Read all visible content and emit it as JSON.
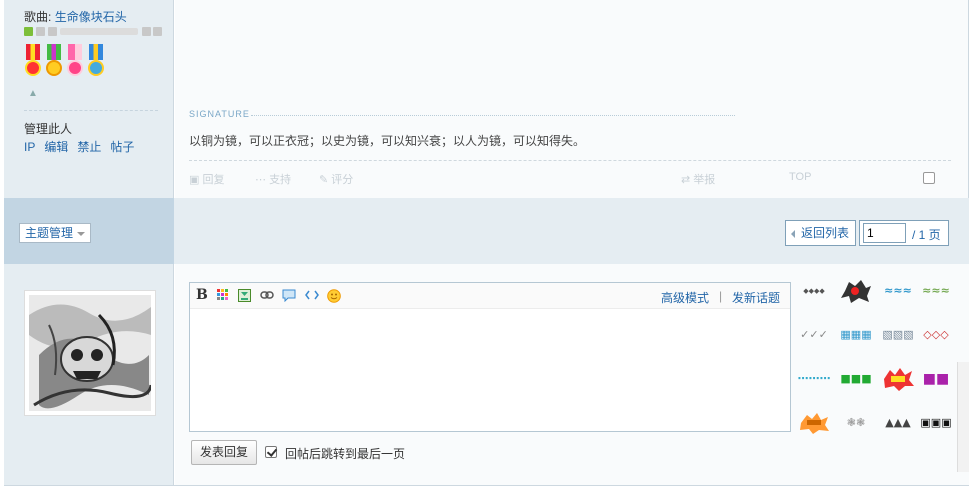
{
  "author": {
    "song_prefix": "歌曲:",
    "song_title": "生命像块石头",
    "manage_title": "管理此人",
    "manage_links": [
      "IP",
      "编辑",
      "禁止",
      "帖子"
    ]
  },
  "post": {
    "signature_label": "SIGNATURE",
    "signature_text": "以铜为镜，可以正衣冠；以史为镜，可以知兴衰；以人为镜，可以知得失。",
    "actions": [
      "回复",
      "支持",
      "评分",
      "举报",
      "TOP"
    ]
  },
  "manage_bar": {
    "topic_manage": "主题管理",
    "back_to_list": "返回列表",
    "page_value": "1",
    "page_total": "/ 1 页"
  },
  "reply": {
    "advanced_mode": "高级模式",
    "separator": "|",
    "new_topic": "发新话题",
    "submit": "发表回复",
    "jump_label": "回帖后跳转到最后一页",
    "jump_checked": true,
    "toolbar_icons": [
      "bold-icon",
      "color-icon",
      "image-icon",
      "link-icon",
      "quote-icon",
      "code-icon",
      "smiley-icon"
    ],
    "bold_glyph": "B"
  },
  "colors": {
    "link": "#2366a8",
    "panel": "#e5edf2",
    "bar": "#c2d5e3"
  }
}
